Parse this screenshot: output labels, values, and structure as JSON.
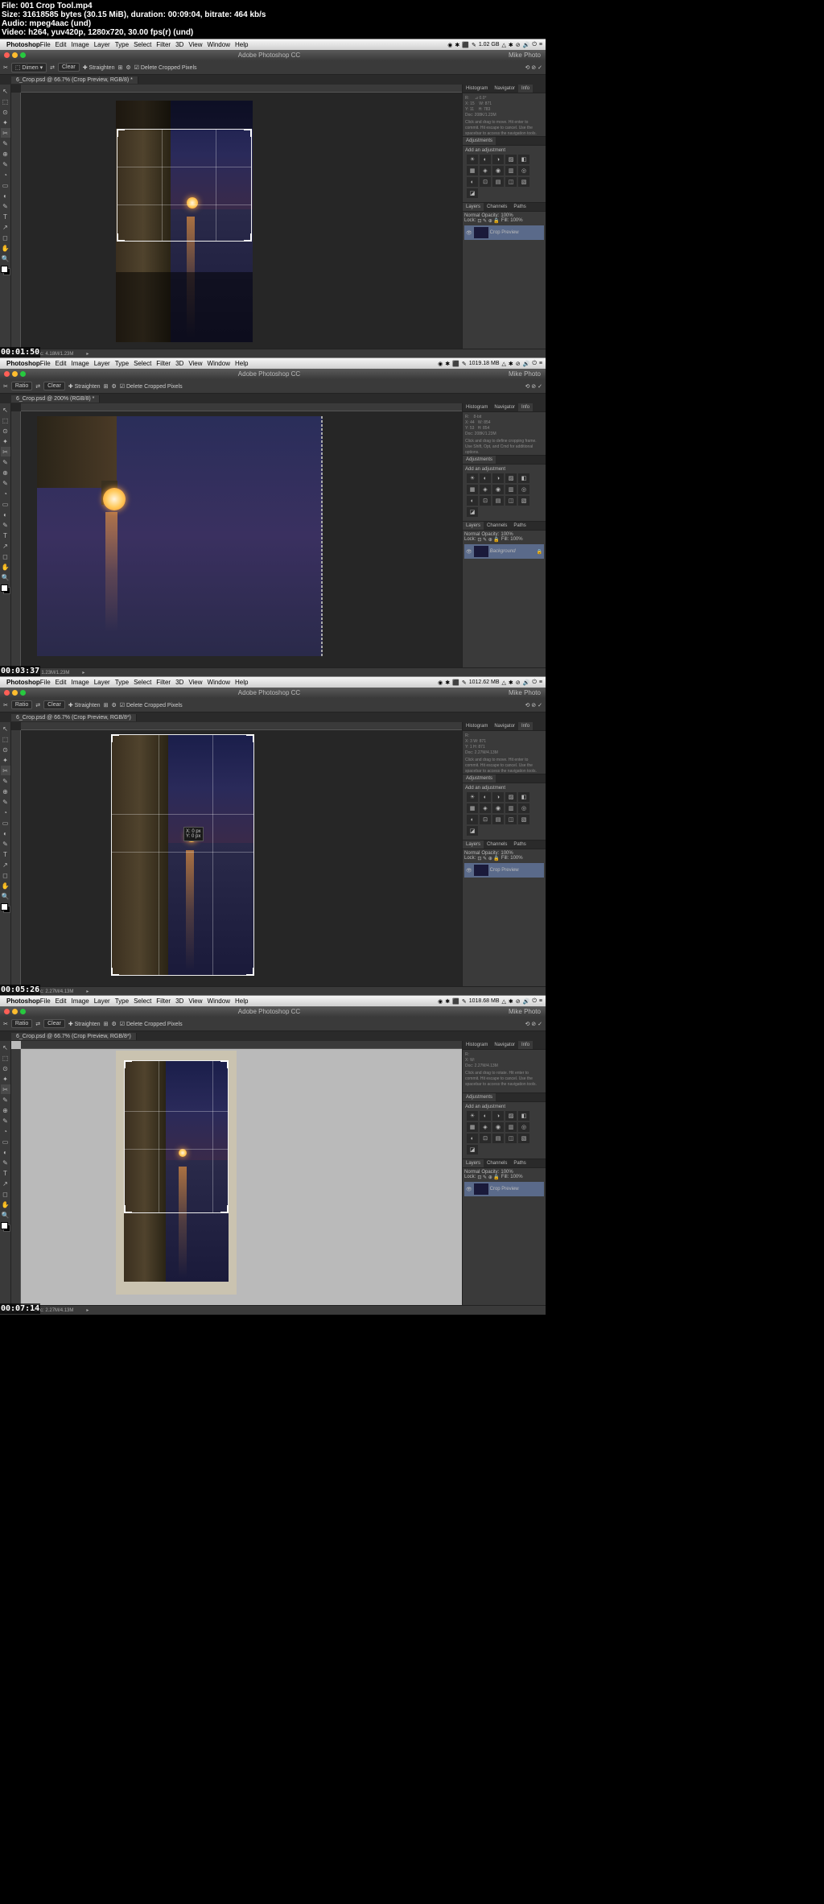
{
  "meta": {
    "file": "File: 001 Crop Tool.mp4",
    "size": "Size: 31618585 bytes (30.15 MiB), duration: 00:09:04, bitrate: 464 kb/s",
    "audio": "Audio: mpeg4aac (und)",
    "video": "Video: h264, yuv420p, 1280x720, 30.00 fps(r) (und)"
  },
  "menu": {
    "app": "Photoshop",
    "items": [
      "File",
      "Edit",
      "Image",
      "Layer",
      "Type",
      "Select",
      "Filter",
      "3D",
      "View",
      "Window",
      "Help"
    ]
  },
  "title": "Adobe Photoshop CC",
  "optbar": {
    "ratio": "Ratio",
    "clear": "Clear",
    "straighten": "Straighten",
    "delete": "Delete Cropped Pixels"
  },
  "panels": {
    "histogram": "Histogram",
    "navigator": "Navigator",
    "info": "Info",
    "adjustments": "Adjustments",
    "addadj": "Add an adjustment",
    "layers": "Layers",
    "channels": "Channels",
    "paths": "Paths",
    "normal": "Normal",
    "opacity": "Opacity:",
    "pct": "100%",
    "fill": "Fill:",
    "lock": "Lock:",
    "croppreview": "Crop Preview",
    "background": "Background"
  },
  "frames": [
    {
      "tab": "6_Crop.psd @ 66.7% (Crop Preview, RGB/8) *",
      "zoom": "66.67%",
      "doc": "Doc: 4.18M/1.23M",
      "ts": "00:01:50",
      "mem": "1.02 GB",
      "hint": "Click and drag to move. Hit enter to commit. Hit escape to cancel. Use the spacebar to access the navigation tools."
    },
    {
      "tab": "6_Crop.psd @ 200% (RGB/8) *",
      "zoom": "200%",
      "doc": "Doc: 1.23M/1.23M",
      "ts": "00:03:37",
      "mem": "1019.18 MB",
      "hint": "Click and drag to define cropping frame. Use Shift, Opt, and Cmd for additional options."
    },
    {
      "tab": "6_Crop.psd @ 66.7% (Crop Preview, RGB/8*)",
      "zoom": "66.67%",
      "doc": "Doc: 2.27M/4.13M",
      "ts": "00:05:26",
      "mem": "1012.62 MB",
      "hint": "Click and drag to move. Hit enter to commit. Hit escape to cancel. Use the spacebar to access the navigation tools."
    },
    {
      "tab": "6_Crop.psd @ 66.7% (Crop Preview, RGB/8*)",
      "zoom": "66.67%",
      "doc": "Doc: 2.27M/4.13M",
      "ts": "00:07:14",
      "mem": "1018.68 MB",
      "hint": "Click and drag to rotate. Hit enter to commit. Hit escape to cancel. Use the spacebar to access the navigation tools."
    }
  ],
  "user": "Mike Photo",
  "tooltip": {
    "x": "X: 0 px",
    "y": "Y: 0 px"
  },
  "infopanel": {
    "r": "R:",
    "g": "G:",
    "b": "B:",
    "x": "X:",
    "y": "Y:",
    "w": "W:",
    "h": "H:",
    "deg": "0.0°",
    "wval": "871",
    "hval": "783",
    "doc1": "Doc: 208K/1.23M"
  }
}
